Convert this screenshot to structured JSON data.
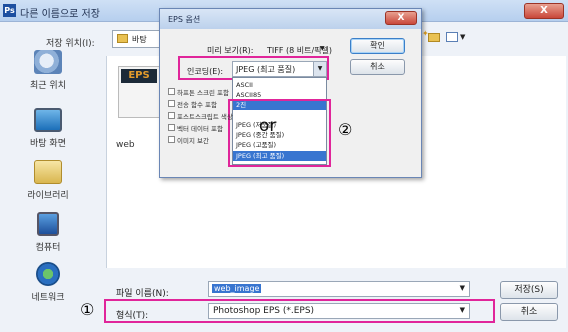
{
  "save_as_dialog": {
    "title": "다른 이름으로 저장",
    "save_in_label": "저장 위치(I):",
    "save_in_value": "바탕",
    "places": [
      {
        "label": "최근 위치",
        "icon": "recent-places-icon"
      },
      {
        "label": "바탕 화면",
        "icon": "desktop-icon"
      },
      {
        "label": "라이브러리",
        "icon": "libraries-icon"
      },
      {
        "label": "컴퓨터",
        "icon": "computer-icon"
      },
      {
        "label": "네트워크",
        "icon": "network-icon"
      }
    ],
    "file": {
      "badge": "EPS",
      "name": "web"
    },
    "file_name_label": "파일 이름(N):",
    "file_name_value": "web_image",
    "format_label": "형식(T):",
    "format_value": "Photoshop EPS (*.EPS)",
    "save_button": "저장(S)",
    "cancel_button": "취소",
    "close_symbol": "X"
  },
  "eps_options": {
    "title": "EPS 옵션",
    "preview_label": "미리 보기(R):",
    "preview_value": "TIFF (8 비트/픽셀)",
    "encoding_label": "인코딩(E):",
    "encoding_value": "JPEG (최고 품질)",
    "encoding_options": [
      "ASCII",
      "ASCII85",
      "2진",
      "JPEG (저품질)",
      "JPEG (중간 품질)",
      "JPEG (고품질)",
      "JPEG (최고 품질)"
    ],
    "selected_index": 2,
    "checkboxes": [
      "하프톤 스크린 포함",
      "전송 함수 포함",
      "포스트스크립트 색상",
      "벡터 데이터 포함",
      "이미지 보간"
    ],
    "ok_button": "확인",
    "cancel_button": "취소",
    "close_symbol": "X"
  },
  "annotations": {
    "marker_1": "①",
    "marker_2": "②",
    "or_text": "or"
  }
}
